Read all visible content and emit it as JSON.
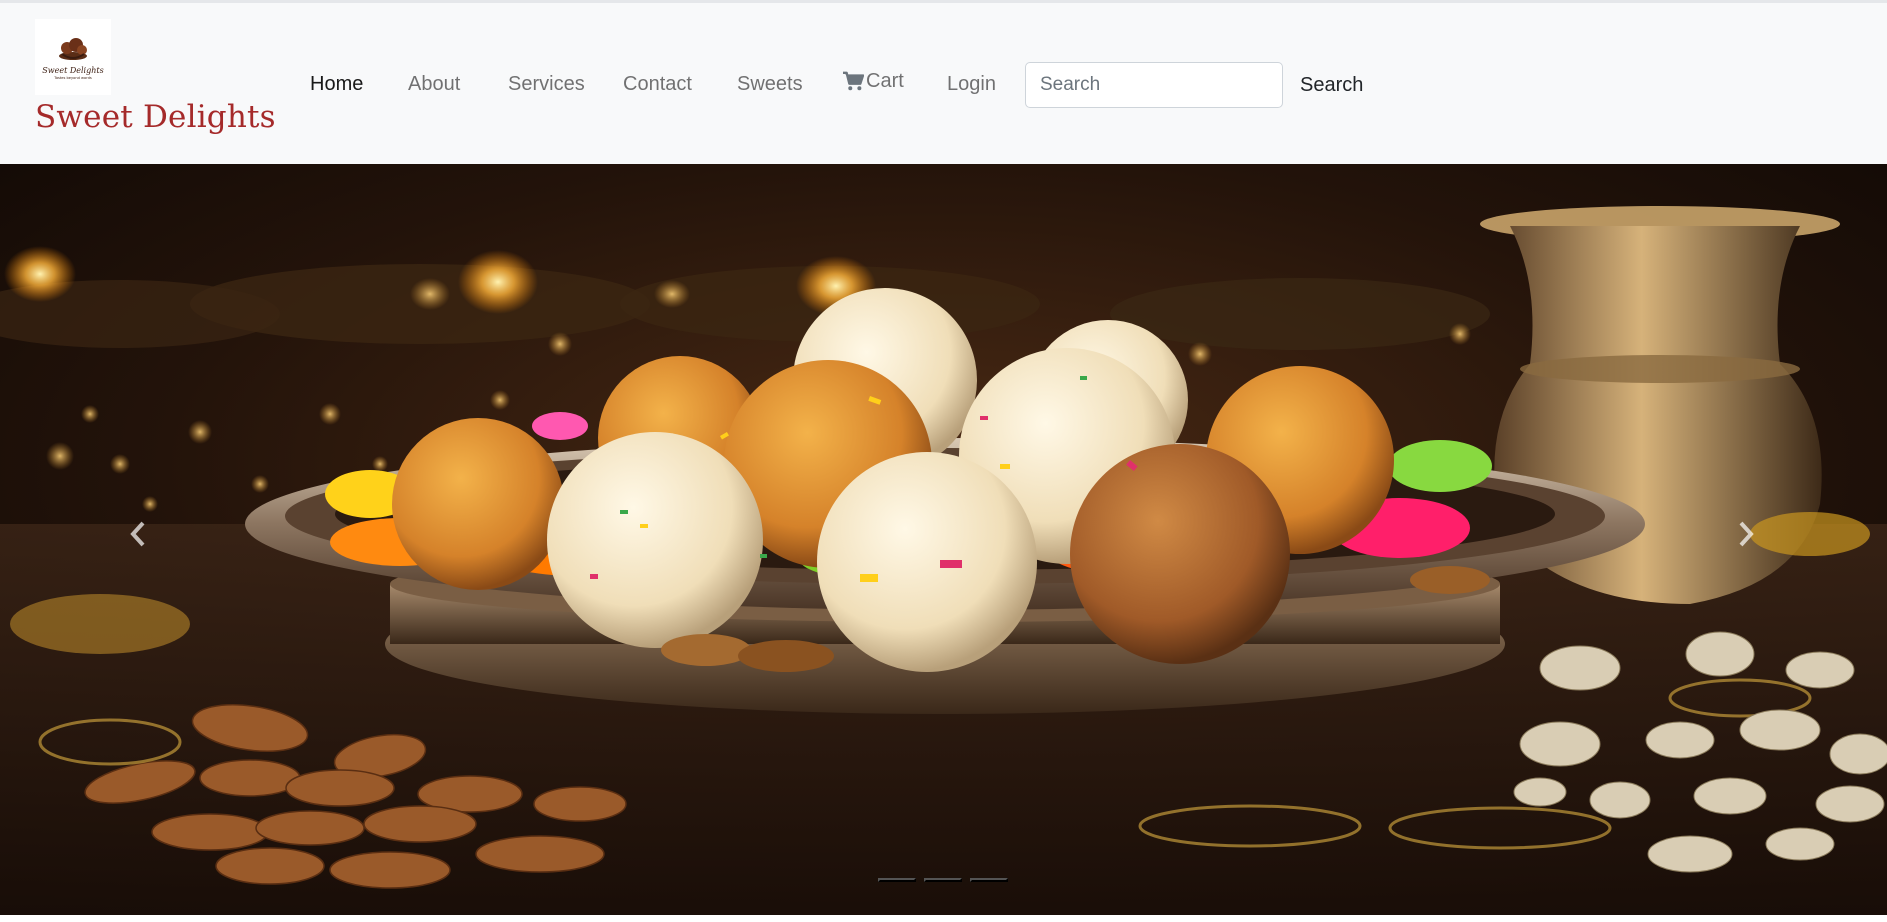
{
  "brand": {
    "name": "Sweet Delights",
    "logo_text": "Sweet Delights",
    "logo_tagline": "Tastes beyond words"
  },
  "nav": {
    "items": [
      {
        "label": "Home",
        "active": true
      },
      {
        "label": "About",
        "active": false
      },
      {
        "label": "Services",
        "active": false
      },
      {
        "label": "Contact",
        "active": false
      },
      {
        "label": "Sweets",
        "active": false
      },
      {
        "label": "Cart",
        "active": false,
        "icon": "cart-icon"
      },
      {
        "label": "Login",
        "active": false
      }
    ]
  },
  "search": {
    "placeholder": "Search",
    "button_label": "Search"
  },
  "carousel": {
    "slide_count": 3,
    "active_slide": 1,
    "prev_icon": "chevron-left-icon",
    "next_icon": "chevron-right-icon"
  },
  "colors": {
    "brand": "#a52a2a",
    "navbar_bg": "#f8f9fa",
    "link_active": "#212529",
    "link_muted": "#7a7d80"
  }
}
